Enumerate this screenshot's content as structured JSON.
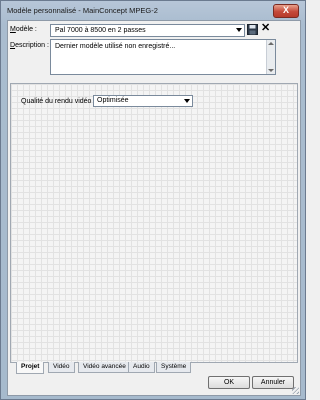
{
  "window": {
    "title": "Modèle personnalisé - MainConcept MPEG-2",
    "close_label": "X"
  },
  "model": {
    "label": "Modèle :",
    "selected": "Pal 7000 à 8500 en 2 passes",
    "save_icon": "floppy-disk-icon",
    "delete_icon": "close-x-icon",
    "delete_glyph": "✕"
  },
  "description": {
    "label": "Description :",
    "value": "Dernier modèle utilisé non enregistré..."
  },
  "quality": {
    "label": "Qualité du rendu vidéo :",
    "selected": "Optimisée"
  },
  "tabs": [
    {
      "label": "Projet",
      "active": true
    },
    {
      "label": "Vidéo",
      "active": false
    },
    {
      "label": "Vidéo avancée",
      "active": false
    },
    {
      "label": "Audio",
      "active": false
    },
    {
      "label": "Système",
      "active": false
    }
  ],
  "buttons": {
    "ok": "OK",
    "cancel": "Annuler"
  }
}
